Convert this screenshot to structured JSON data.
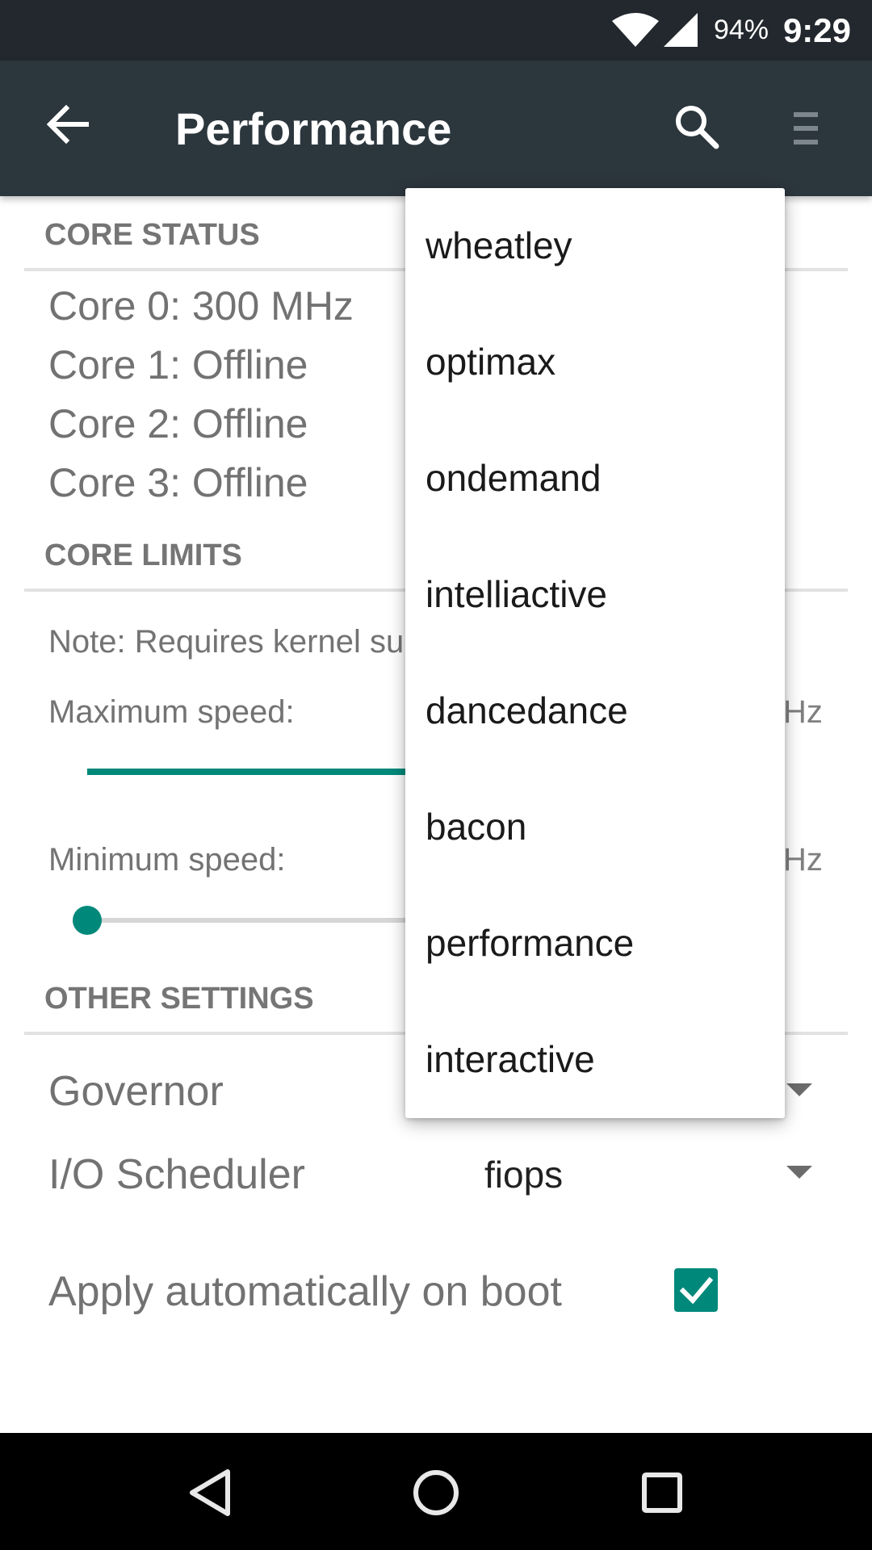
{
  "status_bar": {
    "battery": "94%",
    "time": "9:29"
  },
  "toolbar": {
    "title": "Performance"
  },
  "core_status": {
    "header": "CORE STATUS",
    "lines": [
      "Core 0: 300 MHz",
      "Core 1: Offline",
      "Core 2: Offline",
      "Core 3: Offline"
    ]
  },
  "core_limits": {
    "header": "CORE LIMITS",
    "note": "Note: Requires kernel su",
    "max_label": "Maximum speed:",
    "max_unit_partial": "Hz",
    "min_label": "Minimum speed:",
    "min_unit_partial": "Hz"
  },
  "other_settings": {
    "header": "OTHER SETTINGS",
    "governor_label": "Governor",
    "io_label": "I/O Scheduler",
    "io_value": "fiops",
    "boot_label": "Apply automatically on boot",
    "boot_checked": true
  },
  "governor_menu": {
    "options": [
      "wheatley",
      "optimax",
      "ondemand",
      "intelliactive",
      "dancedance",
      "bacon",
      "performance",
      "interactive"
    ]
  },
  "colors": {
    "accent": "#00897b",
    "toolbar": "#2c363d",
    "status_bar": "#22282d"
  }
}
